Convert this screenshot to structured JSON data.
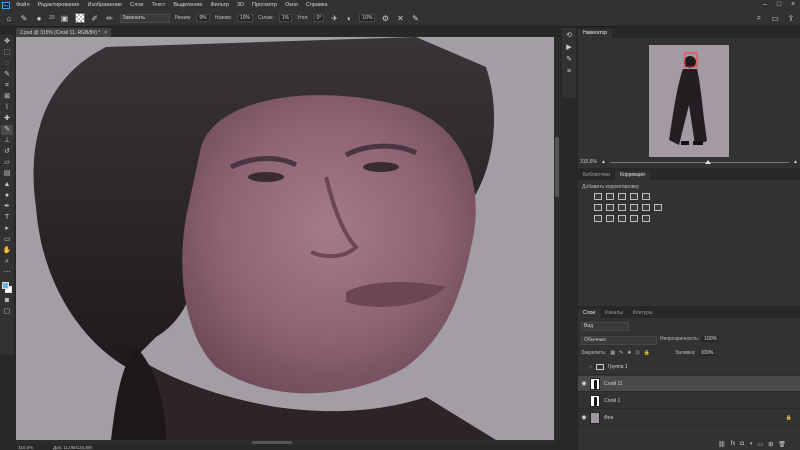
{
  "menu": {
    "logo": "Ps",
    "items": [
      "Файл",
      "Редактирование",
      "Изображение",
      "Слои",
      "Текст",
      "Выделение",
      "Фильтр",
      "3D",
      "Просмотр",
      "Окно",
      "Справка"
    ]
  },
  "options": {
    "brush_size": "20",
    "mode_label": "Режим:",
    "mode_value": "Заменить",
    "strength_label": "Нажим:",
    "strength_value": "9%",
    "flow_label": "Нажим:",
    "flow_value": "10%",
    "smooth_label": "Сглаж:",
    "smooth_value": "1%",
    "angle_label": "Угол:",
    "angle_value": "0°",
    "hardness_value": "10%"
  },
  "document": {
    "tab_title": "2.psd @ 315% (Слой 11, RGB/8#) *",
    "close_glyph": "×"
  },
  "status": {
    "zoom": "315,6%",
    "doc": "Док: 11,0М/134,9М"
  },
  "navigator": {
    "tabs": [
      "Навигатор"
    ],
    "zoom": "315,6%"
  },
  "adjustments": {
    "tabs": [
      "Библиотеки",
      "Коррекция"
    ],
    "title": "Добавить корректировку"
  },
  "layers": {
    "tabs": [
      "Слои",
      "Каналы",
      "Контуры"
    ],
    "search": "Вид",
    "blend_mode": "Обычные",
    "opacity_label": "Непрозрачность:",
    "opacity_value": "100%",
    "lock_label": "Закрепить:",
    "fill_label": "Заливка:",
    "fill_value": "100%",
    "items": [
      {
        "name": "Группа 1"
      },
      {
        "name": "Слой 11"
      },
      {
        "name": "Слой 1"
      },
      {
        "name": "Фон"
      }
    ]
  }
}
